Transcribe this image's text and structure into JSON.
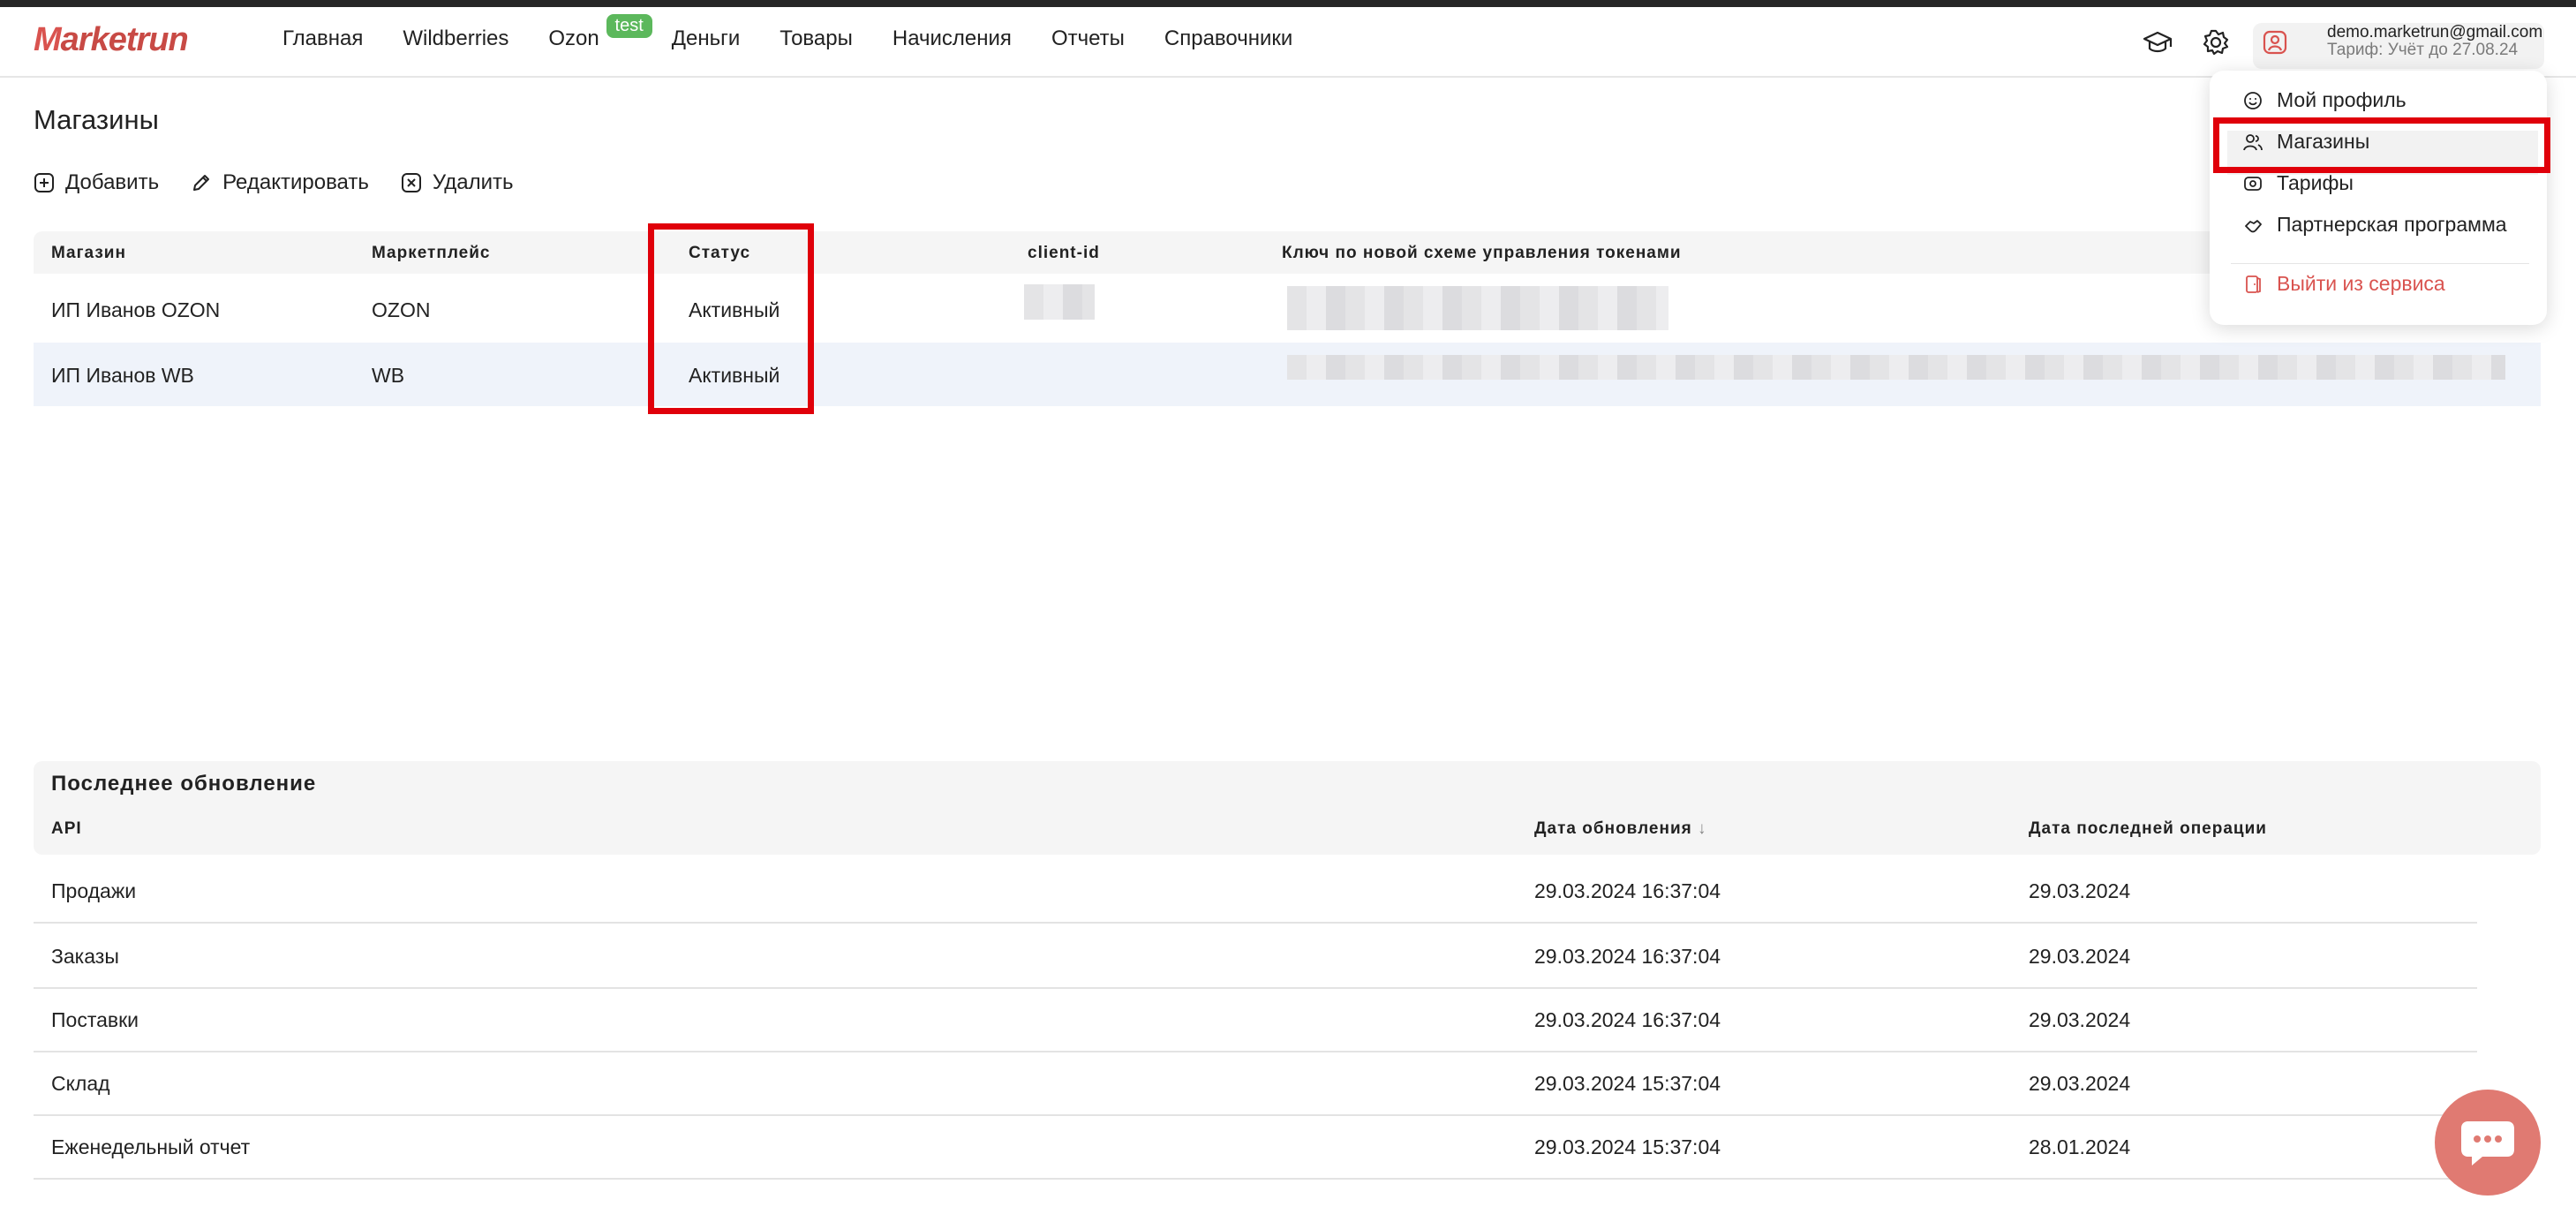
{
  "header": {
    "logo_m": "M",
    "logo_rest": "arketrun",
    "nav": [
      "Главная",
      "Wildberries",
      "Ozon",
      "Деньги",
      "Товары",
      "Начисления",
      "Отчеты",
      "Справочники"
    ],
    "ozon_badge": "test",
    "account_email": "demo.marketrun@gmail.com",
    "account_tariff": "Тариф: Учёт до 27.08.24"
  },
  "page": {
    "title": "Магазины",
    "toolbar": {
      "add": "Добавить",
      "edit": "Редактировать",
      "delete": "Удалить"
    }
  },
  "shops": {
    "columns": [
      "Магазин",
      "Маркетплейс",
      "Статус",
      "client-id",
      "Ключ по новой схеме управления токенами"
    ],
    "rows": [
      {
        "shop": "ИП Иванов OZON",
        "marketplace": "OZON",
        "status": "Активный"
      },
      {
        "shop": "ИП Иванов WB",
        "marketplace": "WB",
        "status": "Активный"
      }
    ]
  },
  "dropdown": {
    "items": [
      "Мой профиль",
      "Магазины",
      "Тарифы",
      "Партнерская программа"
    ],
    "logout": "Выйти из сервиса"
  },
  "updates": {
    "title": "Последнее обновление",
    "columns": [
      "API",
      "Дата обновления",
      "Дата последней операции"
    ],
    "sort_arrow": "↓",
    "rows": [
      {
        "api": "Продажи",
        "updated": "29.03.2024 16:37:04",
        "last_op": "29.03.2024"
      },
      {
        "api": "Заказы",
        "updated": "29.03.2024 16:37:04",
        "last_op": "29.03.2024"
      },
      {
        "api": "Поставки",
        "updated": "29.03.2024 16:37:04",
        "last_op": "29.03.2024"
      },
      {
        "api": "Склад",
        "updated": "29.03.2024 15:37:04",
        "last_op": "29.03.2024"
      },
      {
        "api": "Еженедельный отчет",
        "updated": "29.03.2024 15:37:04",
        "last_op": "28.01.2024"
      }
    ]
  },
  "colors": {
    "brand": "#d9534f",
    "highlight": "#e0000a",
    "badge": "#5cb85c",
    "logout": "#d9534f",
    "chat": "#e07a72"
  },
  "icons": [
    "graduation-cap-icon",
    "gear-icon",
    "user-icon",
    "plus-square-icon",
    "pencil-icon",
    "x-square-icon",
    "smile-icon",
    "users-icon",
    "cash-icon",
    "handshake-icon",
    "logout-icon",
    "chat-icon"
  ]
}
